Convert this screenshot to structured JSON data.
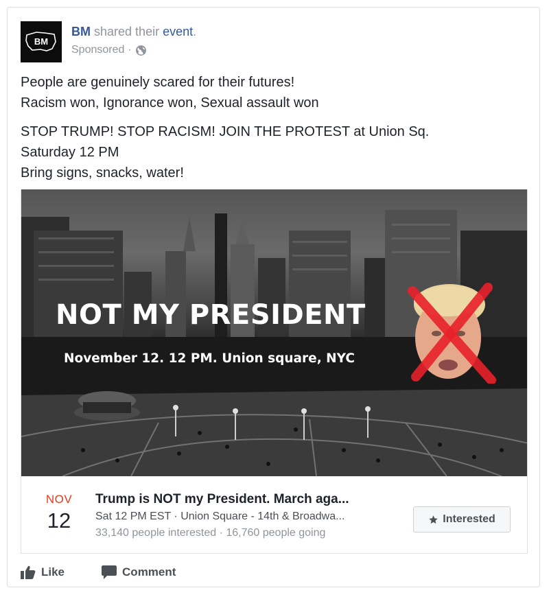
{
  "post": {
    "author": "BM",
    "action_text": "shared their",
    "object_link": "event",
    "period": ".",
    "sponsored": "Sponsored",
    "separator": "·",
    "avatar_text": "BM",
    "lines_1": [
      "People are genuinely scared for their futures!",
      "Racism won, Ignorance won, Sexual assault won"
    ],
    "lines_2": [
      "STOP TRUMP! STOP RACISM! JOIN THE PROTEST at Union Sq.",
      "Saturday 12 PM",
      "Bring signs, snacks, water!"
    ]
  },
  "image": {
    "headline": "NOT MY PRESIDENT",
    "subline": "November 12. 12 PM. Union square, NYC"
  },
  "event": {
    "month": "NOV",
    "day": "12",
    "title": "Trump is NOT my President. March aga...",
    "meta": "Sat 12 PM EST · Union Square - 14th & Broadwa...",
    "stats": "33,140 people interested · 16,760 people going",
    "button_label": "Interested",
    "button_icon": "star-icon"
  },
  "actions": {
    "like": "Like",
    "comment": "Comment"
  },
  "colors": {
    "link": "#365899",
    "month": "#e8391f",
    "muted": "#90949c",
    "x_mark": "#e8212a"
  }
}
